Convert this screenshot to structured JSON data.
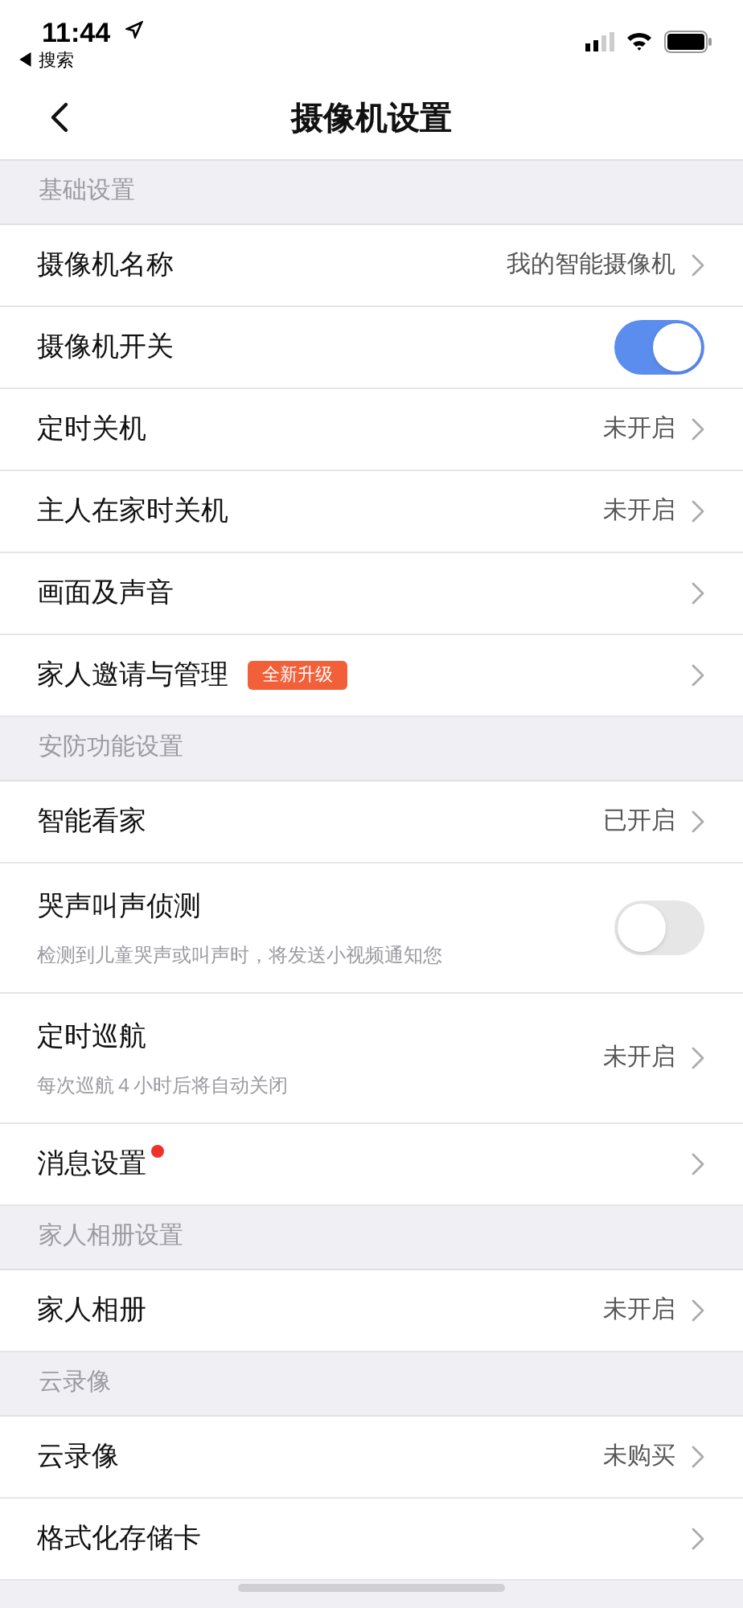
{
  "status_bar": {
    "time": "11:44",
    "back_app": "◀ 搜索"
  },
  "nav": {
    "title": "摄像机设置"
  },
  "sections": [
    {
      "header": "基础设置",
      "items": [
        {
          "kind": "link",
          "label": "摄像机名称",
          "value": "我的智能摄像机"
        },
        {
          "kind": "toggle",
          "label": "摄像机开关",
          "on": true
        },
        {
          "kind": "link",
          "label": "定时关机",
          "value": "未开启"
        },
        {
          "kind": "link",
          "label": "主人在家时关机",
          "value": "未开启"
        },
        {
          "kind": "link",
          "label": "画面及声音"
        },
        {
          "kind": "link",
          "label": "家人邀请与管理",
          "badge": "全新升级"
        }
      ]
    },
    {
      "header": "安防功能设置",
      "items": [
        {
          "kind": "link",
          "label": "智能看家",
          "value": "已开启"
        },
        {
          "kind": "toggle",
          "label": "哭声叫声侦测",
          "subtitle": "检测到儿童哭声或叫声时，将发送小视频通知您",
          "on": false
        },
        {
          "kind": "link",
          "label": "定时巡航",
          "subtitle": "每次巡航４小时后将自动关闭",
          "value": "未开启"
        },
        {
          "kind": "link",
          "label": "消息设置",
          "unread": true
        }
      ]
    },
    {
      "header": "家人相册设置",
      "items": [
        {
          "kind": "link",
          "label": "家人相册",
          "value": "未开启"
        }
      ]
    },
    {
      "header": "云录像",
      "items": [
        {
          "kind": "link",
          "label": "云录像",
          "value": "未购买"
        },
        {
          "kind": "link",
          "label": "格式化存储卡"
        }
      ]
    }
  ]
}
